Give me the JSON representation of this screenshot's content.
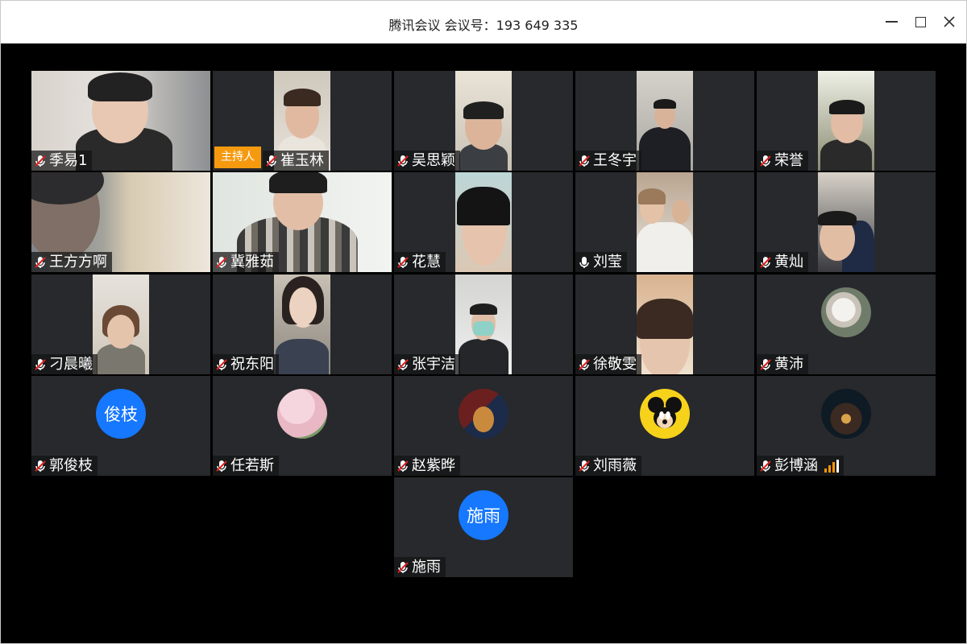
{
  "window": {
    "title": "腾讯会议 会议号：193 649 335",
    "controls": [
      "minimize-icon",
      "maximize-icon",
      "close-icon"
    ]
  },
  "colors": {
    "tile_bg": "#27292c",
    "avatar_blue": "#1677ff",
    "host_badge": "#f59a0f",
    "mic_muted": "#e02020",
    "signal": "#ff9500"
  },
  "host_badge_label": "主持人",
  "participants": [
    {
      "name": "季易1",
      "mic": "muted",
      "media": "video"
    },
    {
      "name": "崔玉林",
      "mic": "muted",
      "media": "video",
      "host": true
    },
    {
      "name": "吴思颖",
      "mic": "muted",
      "media": "video"
    },
    {
      "name": "王冬宇",
      "mic": "muted",
      "media": "video"
    },
    {
      "name": "荣誉",
      "mic": "muted",
      "media": "video"
    },
    {
      "name": "王方方啊",
      "mic": "muted",
      "media": "video"
    },
    {
      "name": "冀雅茹",
      "mic": "muted",
      "media": "video"
    },
    {
      "name": "花慧",
      "mic": "muted",
      "media": "video"
    },
    {
      "name": "刘莹",
      "mic": "on",
      "media": "video"
    },
    {
      "name": "黄灿",
      "mic": "muted",
      "media": "video"
    },
    {
      "name": "刁晨曦",
      "mic": "muted",
      "media": "video"
    },
    {
      "name": "祝东阳",
      "mic": "muted",
      "media": "video"
    },
    {
      "name": "张宇洁",
      "mic": "muted",
      "media": "video"
    },
    {
      "name": "徐敬雯",
      "mic": "muted",
      "media": "video"
    },
    {
      "name": "黄沛",
      "mic": "muted",
      "media": "avatar-image",
      "avatar_icon": "cat-avatar-icon"
    },
    {
      "name": "郭俊枝",
      "mic": "muted",
      "media": "avatar-text",
      "avatar_text": "俊枝"
    },
    {
      "name": "任若斯",
      "mic": "muted",
      "media": "avatar-image",
      "avatar_icon": "cherry-blossom-avatar-icon"
    },
    {
      "name": "赵紫晔",
      "mic": "muted",
      "media": "avatar-image",
      "avatar_icon": "cartoon-mouse-avatar-icon"
    },
    {
      "name": "刘雨薇",
      "mic": "muted",
      "media": "avatar-image",
      "avatar_icon": "mickey-mouse-avatar-icon"
    },
    {
      "name": "彭博涵",
      "mic": "muted",
      "media": "avatar-image",
      "avatar_icon": "city-night-avatar-icon",
      "signal_icon": "signal-strength-icon"
    },
    {
      "name": "施雨",
      "mic": "muted",
      "media": "avatar-text",
      "avatar_text": "施雨"
    }
  ]
}
